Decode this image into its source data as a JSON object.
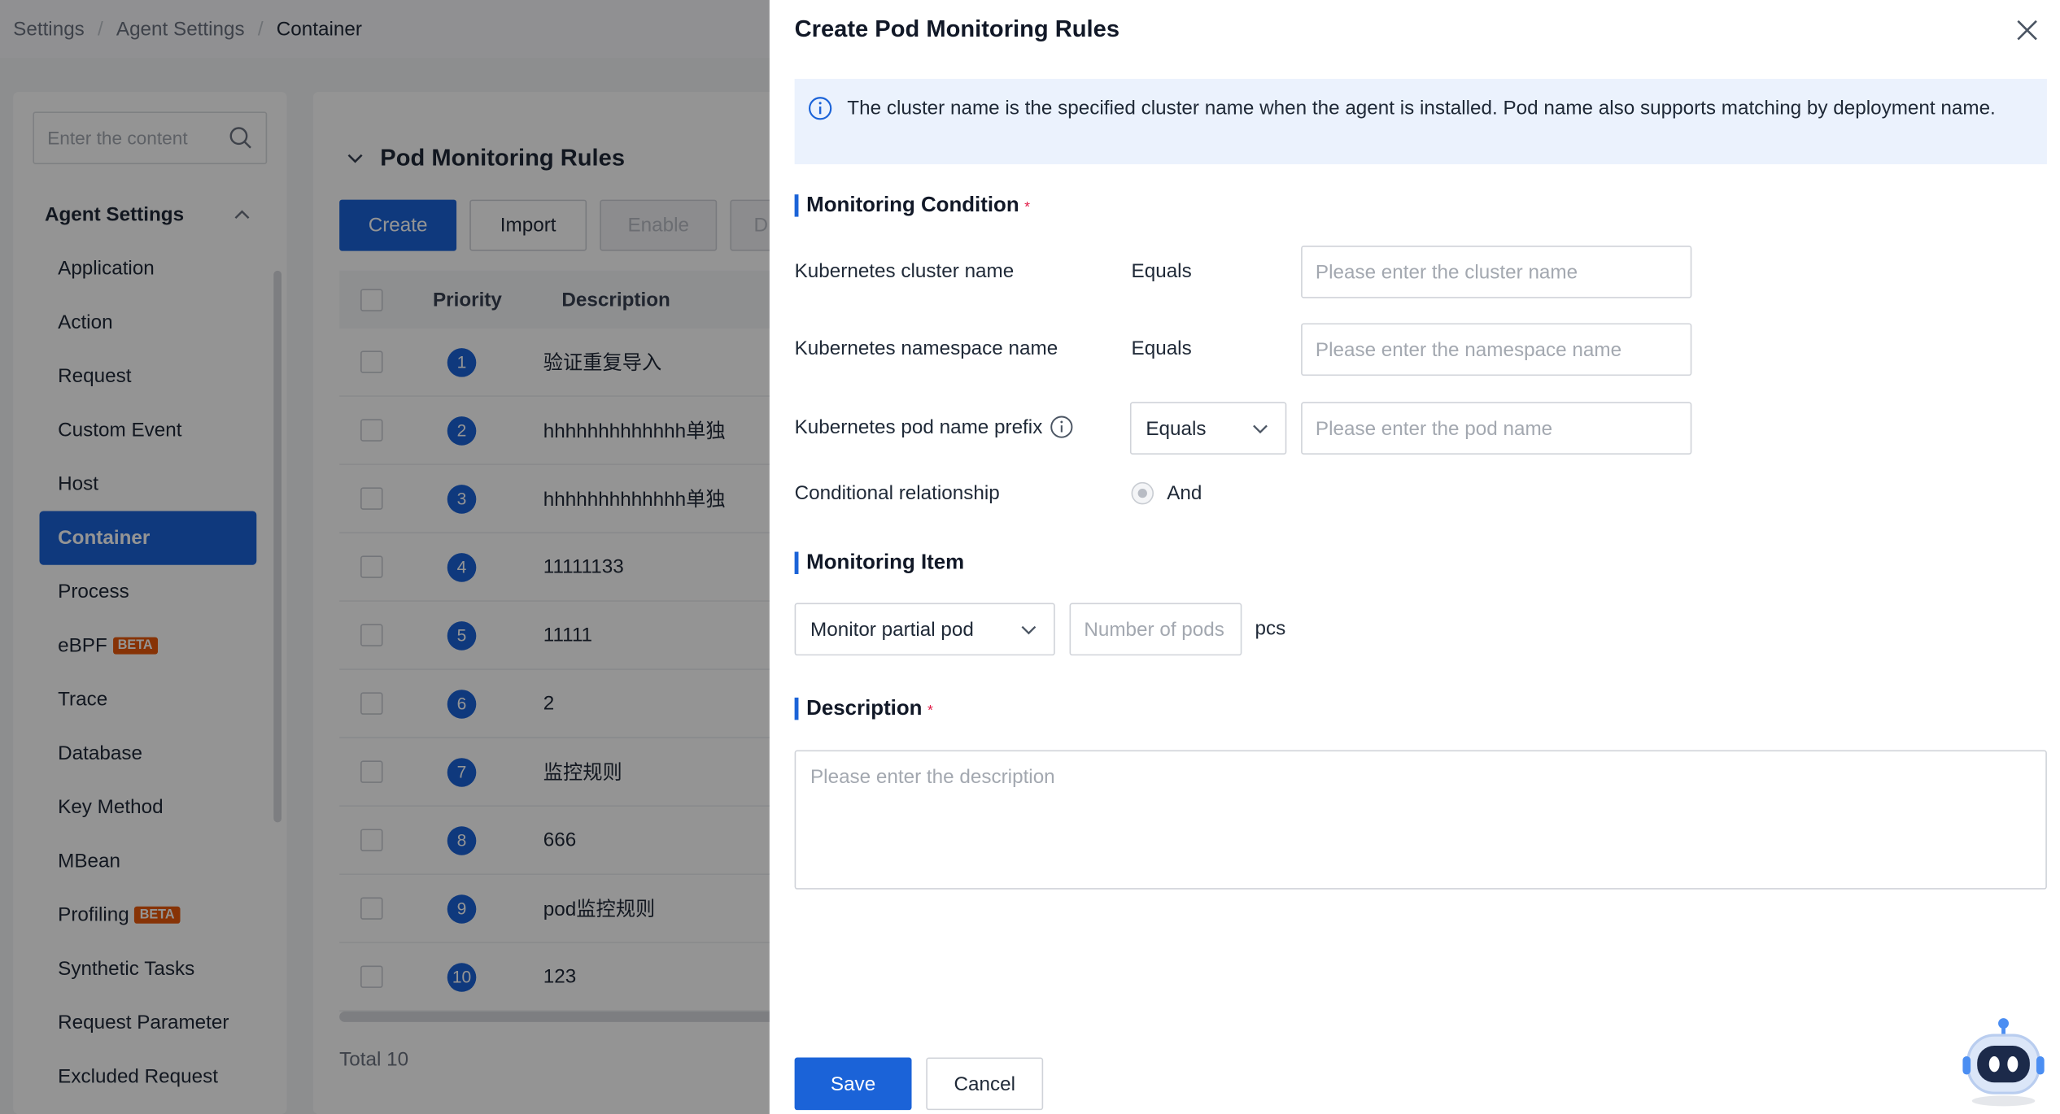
{
  "breadcrumb": {
    "items": [
      "Settings",
      "Agent Settings"
    ],
    "current": "Container"
  },
  "sidebar": {
    "search_placeholder": "Enter the content",
    "group_title": "Agent Settings",
    "items": [
      {
        "label": "Application"
      },
      {
        "label": "Action"
      },
      {
        "label": "Request"
      },
      {
        "label": "Custom Event"
      },
      {
        "label": "Host"
      },
      {
        "label": "Container",
        "active": true
      },
      {
        "label": "Process"
      },
      {
        "label": "eBPF",
        "badge": "BETA"
      },
      {
        "label": "Trace"
      },
      {
        "label": "Database"
      },
      {
        "label": "Key Method"
      },
      {
        "label": "MBean"
      },
      {
        "label": "Profiling",
        "badge": "BETA"
      },
      {
        "label": "Synthetic Tasks"
      },
      {
        "label": "Request Parameter"
      },
      {
        "label": "Excluded Request"
      }
    ]
  },
  "main": {
    "section_title": "Pod Monitoring Rules",
    "buttons": {
      "create": "Create",
      "import": "Import",
      "enable": "Enable",
      "partial": "D"
    },
    "table": {
      "headers": {
        "priority": "Priority",
        "description": "Description"
      },
      "rows": [
        {
          "priority": "1",
          "description": "验证重复导入"
        },
        {
          "priority": "2",
          "description": "hhhhhhhhhhhhh单独"
        },
        {
          "priority": "3",
          "description": "hhhhhhhhhhhhh单独"
        },
        {
          "priority": "4",
          "description": "11111133"
        },
        {
          "priority": "5",
          "description": "11111"
        },
        {
          "priority": "6",
          "description": "2"
        },
        {
          "priority": "7",
          "description": "监控规则"
        },
        {
          "priority": "8",
          "description": "666"
        },
        {
          "priority": "9",
          "description": "pod监控规则"
        },
        {
          "priority": "10",
          "description": "123"
        }
      ]
    },
    "total": "Total 10"
  },
  "drawer": {
    "title": "Create Pod Monitoring Rules",
    "info": "The cluster name is the specified cluster name when the agent is installed. Pod name also supports matching by deployment name.",
    "condition_title": "Monitoring Condition",
    "required_mark": "*",
    "cluster": {
      "label": "Kubernetes cluster name",
      "operator": "Equals",
      "placeholder": "Please enter the cluster name"
    },
    "namespace": {
      "label": "Kubernetes namespace name",
      "operator": "Equals",
      "placeholder": "Please enter the namespace name"
    },
    "pod": {
      "label": "Kubernetes pod name prefix",
      "operator": "Equals",
      "placeholder": "Please enter the pod name"
    },
    "relationship": {
      "label": "Conditional relationship",
      "value": "And"
    },
    "item_title": "Monitoring Item",
    "monitor_mode": "Monitor partial pod",
    "pods_placeholder": "Number of pods",
    "unit": "pcs",
    "description_title": "Description",
    "description_placeholder": "Please enter the description",
    "save": "Save",
    "cancel": "Cancel"
  },
  "colors": {
    "primary": "#1b63d8",
    "beta": "#e8590c",
    "required": "#e11d48",
    "info_bg": "#ebf2fd"
  }
}
